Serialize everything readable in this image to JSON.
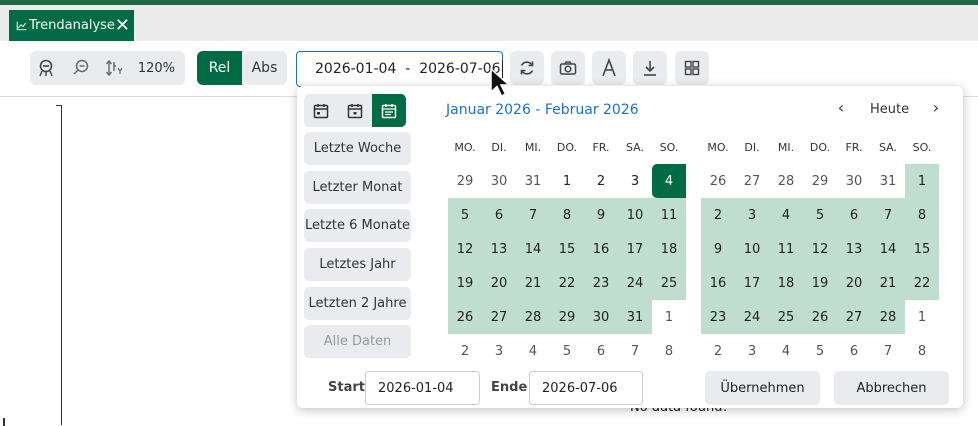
{
  "tab": {
    "label": "Trendanalyse",
    "close": "✕"
  },
  "toolbar": {
    "zoom_level": "120%",
    "rel_label": "Rel",
    "abs_label": "Abs",
    "date_range_value": "2026-01-04  -  2026-07-06"
  },
  "chart": {
    "no_data": "No data found!"
  },
  "picker": {
    "presets": [
      "Letzte Woche",
      "Letzter Monat",
      "Letzte 6 Monate",
      "Letztes Jahr",
      "Letzten 2 Jahre",
      "Alle Daten"
    ],
    "title": "Januar 2026 - Februar 2026",
    "prev": "‹",
    "today": "Heute",
    "next": "›",
    "weekdays": [
      "MO.",
      "DI.",
      "MI.",
      "DO.",
      "FR.",
      "SA.",
      "SO."
    ],
    "january_weeks": [
      [
        "29",
        "30",
        "31",
        "1",
        "2",
        "3",
        "4"
      ],
      [
        "5",
        "6",
        "7",
        "8",
        "9",
        "10",
        "11"
      ],
      [
        "12",
        "13",
        "14",
        "15",
        "16",
        "17",
        "18"
      ],
      [
        "19",
        "20",
        "21",
        "22",
        "23",
        "24",
        "25"
      ],
      [
        "26",
        "27",
        "28",
        "29",
        "30",
        "31",
        "1"
      ],
      [
        "2",
        "3",
        "4",
        "5",
        "6",
        "7",
        "8"
      ]
    ],
    "february_weeks": [
      [
        "26",
        "27",
        "28",
        "29",
        "30",
        "31",
        "1"
      ],
      [
        "2",
        "3",
        "4",
        "5",
        "6",
        "7",
        "8"
      ],
      [
        "9",
        "10",
        "11",
        "12",
        "13",
        "14",
        "15"
      ],
      [
        "16",
        "17",
        "18",
        "19",
        "20",
        "21",
        "22"
      ],
      [
        "23",
        "24",
        "25",
        "26",
        "27",
        "28",
        "1"
      ],
      [
        "2",
        "3",
        "4",
        "5",
        "6",
        "7",
        "8"
      ]
    ],
    "start_label": "Start",
    "start_value": "2026-01-04",
    "end_label": "Ende",
    "end_value": "2026-07-06",
    "apply_label": "Übernehmen",
    "cancel_label": "Abbrechen"
  },
  "colors": {
    "brand": "#006b45",
    "range": "#bfdecf",
    "link": "#1b6fd1"
  }
}
